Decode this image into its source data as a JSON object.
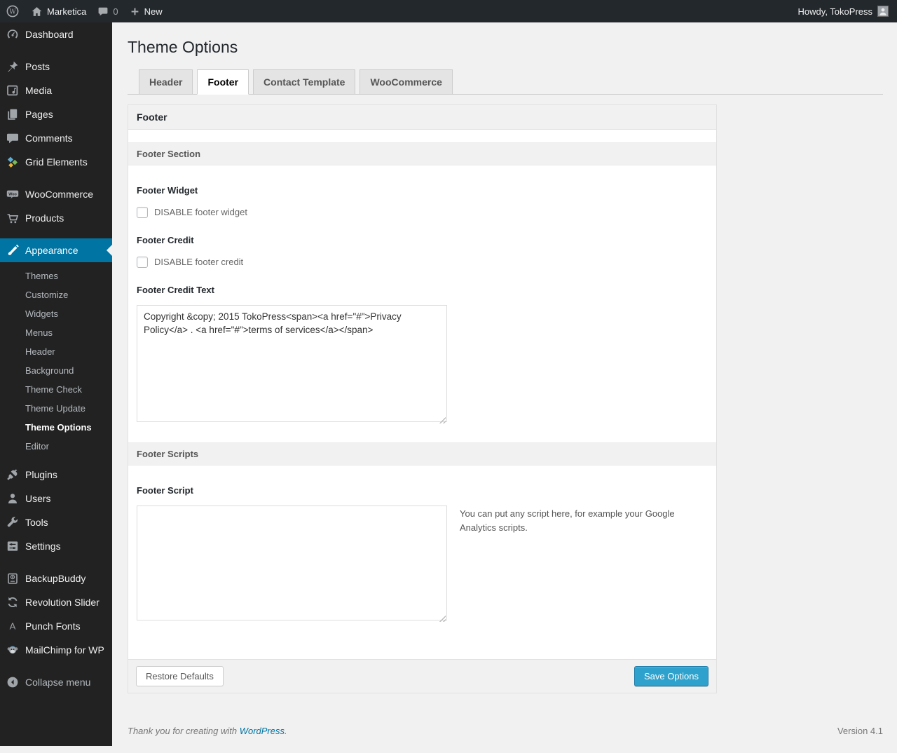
{
  "admin_bar": {
    "site_name": "Marketica",
    "comment_count": "0",
    "new_label": "New",
    "howdy": "Howdy, TokoPress"
  },
  "sidebar": {
    "items": [
      {
        "label": "Dashboard",
        "icon": "dashboard-icon"
      },
      {
        "label": "Posts",
        "icon": "pin-icon"
      },
      {
        "label": "Media",
        "icon": "media-icon"
      },
      {
        "label": "Pages",
        "icon": "pages-icon"
      },
      {
        "label": "Comments",
        "icon": "comments-icon"
      },
      {
        "label": "Grid Elements",
        "icon": "grid-elements-icon"
      },
      {
        "label": "WooCommerce",
        "icon": "woocommerce-icon"
      },
      {
        "label": "Products",
        "icon": "cart-icon"
      },
      {
        "label": "Appearance",
        "icon": "appearance-icon"
      },
      {
        "label": "Plugins",
        "icon": "plugin-icon"
      },
      {
        "label": "Users",
        "icon": "users-icon"
      },
      {
        "label": "Tools",
        "icon": "wrench-icon"
      },
      {
        "label": "Settings",
        "icon": "settings-icon"
      },
      {
        "label": "BackupBuddy",
        "icon": "backupbuddy-icon"
      },
      {
        "label": "Revolution Slider",
        "icon": "revolution-slider-icon"
      },
      {
        "label": "Punch Fonts",
        "icon": "punch-fonts-icon"
      },
      {
        "label": "MailChimp for WP",
        "icon": "mailchimp-icon"
      },
      {
        "label": "Collapse menu",
        "icon": "collapse-icon"
      }
    ],
    "appearance_submenu": [
      "Themes",
      "Customize",
      "Widgets",
      "Menus",
      "Header",
      "Background",
      "Theme Check",
      "Theme Update",
      "Theme Options",
      "Editor"
    ],
    "submenu_current": "Theme Options"
  },
  "page": {
    "title": "Theme Options",
    "tabs": [
      {
        "label": "Header"
      },
      {
        "label": "Footer"
      },
      {
        "label": "Contact Template"
      },
      {
        "label": "WooCommerce"
      }
    ]
  },
  "panel": {
    "box_title": "Footer",
    "footer_section_title": "Footer Section",
    "footer_widget_label": "Footer Widget",
    "footer_widget_checkbox": "DISABLE footer widget",
    "footer_credit_label": "Footer Credit",
    "footer_credit_checkbox": "DISABLE footer credit",
    "footer_credit_text_label": "Footer Credit Text",
    "footer_credit_text_value": "Copyright &copy; 2015 TokoPress<span><a href=\"#\">Privacy Policy</a> . <a href=\"#\">terms of services</a></span>",
    "footer_scripts_title": "Footer Scripts",
    "footer_script_label": "Footer Script",
    "footer_script_value": "",
    "footer_script_help": "You can put any script here, for example your Google Analytics scripts.",
    "restore_button": "Restore Defaults",
    "save_button": "Save Options"
  },
  "footer": {
    "thanks_prefix": "Thank you for creating with ",
    "wordpress_link": "WordPress",
    "thanks_suffix": ".",
    "version": "Version 4.1"
  },
  "colors": {
    "accent": "#0074a2",
    "primary_button": "#2ea2cc",
    "admin_bar_bg": "#23282d",
    "sidebar_bg": "#222222",
    "page_bg": "#f1f1f1"
  }
}
